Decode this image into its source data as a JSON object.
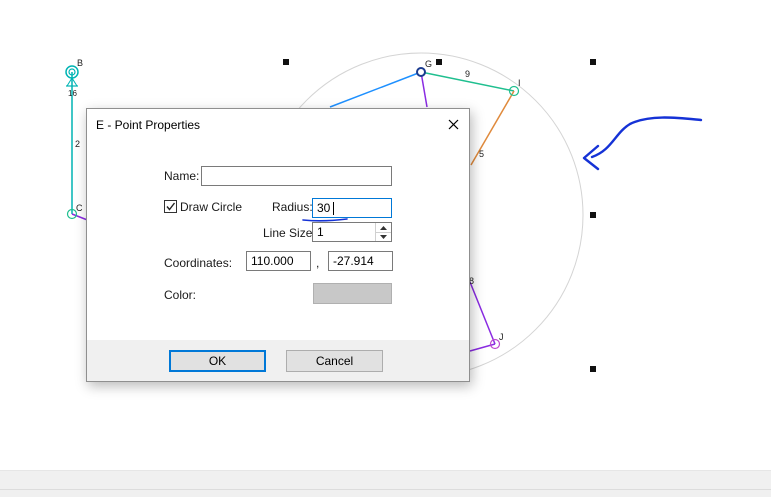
{
  "drawing": {
    "point_labels": {
      "B": "B",
      "G": "G",
      "I": "I",
      "C": "C",
      "J": "J"
    },
    "link_labels": {
      "l2": "2",
      "l9": "9",
      "l5": "5",
      "l8": "8",
      "l16": "16"
    },
    "colors": {
      "cyan": "#00b4b4",
      "blue": "#1e90ff",
      "teal": "#1fbf8f",
      "orange": "#e08a3c",
      "purple": "#8a2be2",
      "circle": "#d4d4d4",
      "annotation": "#1532d6"
    }
  },
  "dialog": {
    "title": "E - Point Properties",
    "close_icon": "close-icon",
    "name": {
      "label": "Name:",
      "value": ""
    },
    "draw_circle": {
      "label": "Draw Circle",
      "checked": true
    },
    "radius": {
      "label": "Radius:",
      "value": "30"
    },
    "line_size": {
      "label": "Line Size:",
      "value": "1"
    },
    "coordinates": {
      "label": "Coordinates:",
      "x": "110.000",
      "separator": ",",
      "y": "-27.914"
    },
    "color": {
      "label": "Color:",
      "swatch": "#c8c8c8"
    },
    "ok_label": "OK",
    "cancel_label": "Cancel"
  }
}
